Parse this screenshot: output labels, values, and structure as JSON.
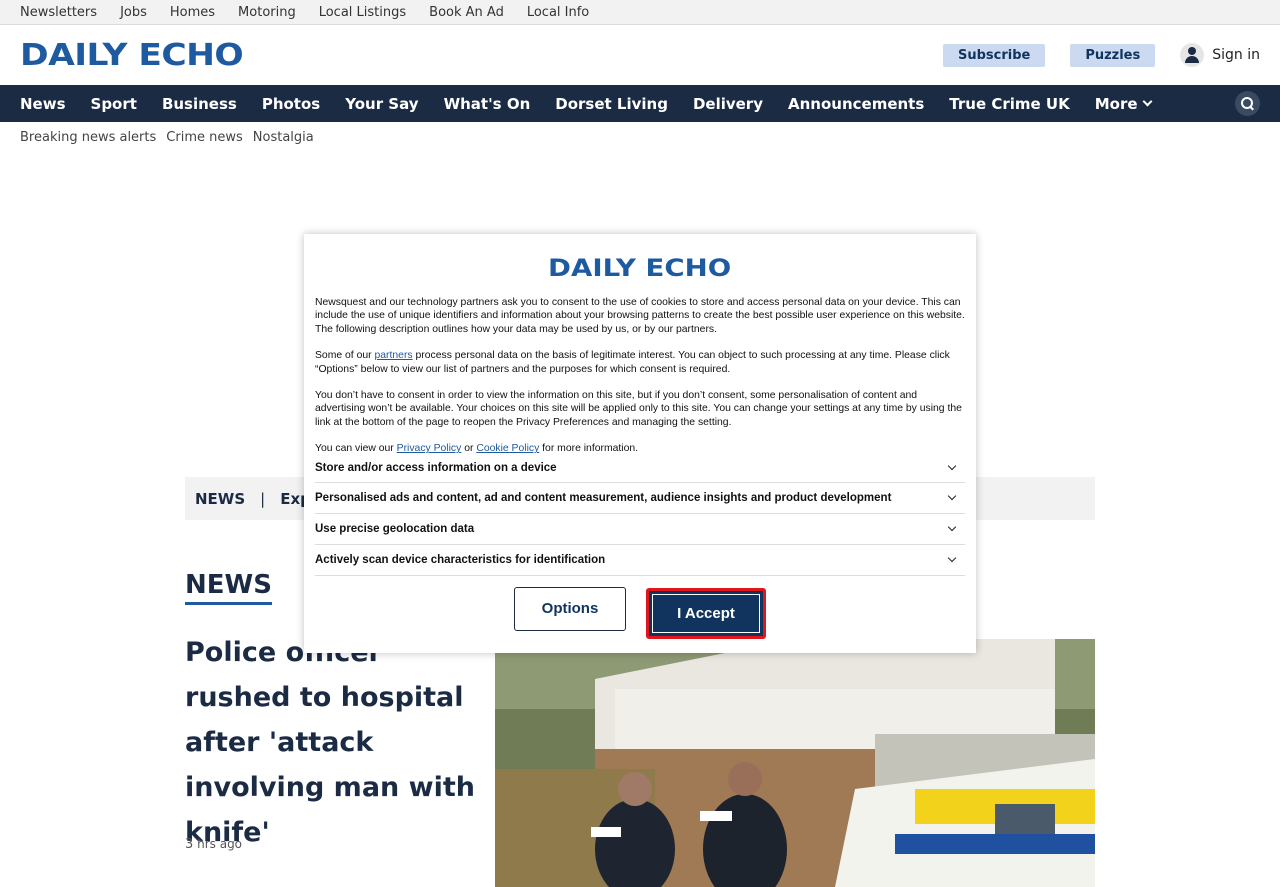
{
  "topbar": {
    "links": [
      "Newsletters",
      "Jobs",
      "Homes",
      "Motoring",
      "Local Listings",
      "Book An Ad",
      "Local Info"
    ]
  },
  "masthead": {
    "logo": "DAILY ECHO",
    "subscribe": "Subscribe",
    "puzzles": "Puzzles",
    "signin": "Sign in"
  },
  "mainnav": {
    "items": [
      "News",
      "Sport",
      "Business",
      "Photos",
      "Your Say",
      "What's On",
      "Dorset Living",
      "Delivery",
      "Announcements",
      "True Crime UK"
    ],
    "more": "More"
  },
  "subnav": {
    "items": [
      "Breaking news alerts",
      "Crime news",
      "Nostalgia"
    ]
  },
  "section_bar": {
    "label": "NEWS",
    "sep": "|",
    "next": "Exp"
  },
  "article": {
    "section": "NEWS",
    "headline": "Police officer rushed to hospital after 'attack involving man with knife'",
    "time_num": "3",
    "time_unit": "hrs ago"
  },
  "modal": {
    "logo": "DAILY ECHO",
    "para1": "Newsquest and our technology partners ask you to consent to the use of cookies to store and access personal data on your device. This can include the use of unique identifiers and information about your browsing patterns to create the best possible user experience on this website. The following description outlines how your data may be used by us, or by our partners.",
    "para2_pre": "Some of our ",
    "para2_link": "partners",
    "para2_post": " process personal data on the basis of legitimate interest. You can object to such processing at any time. Please click “Options” below to view our list of partners and the purposes for which consent is required.",
    "para3": "You don’t have to consent in order to view the information on this site, but if you don’t consent, some personalisation of content and advertising won’t be available. Your choices on this site will be applied only to this site. You can change your settings at any time by using the link at the bottom of the page to reopen the Privacy Preferences and managing the setting.",
    "para4_pre": "You can view our ",
    "para4_link1": "Privacy Policy",
    "para4_mid": " or ",
    "para4_link2": "Cookie Policy",
    "para4_post": " for more information.",
    "purposes": [
      "Store and/or access information on a device",
      "Personalised ads and content, ad and content measurement, audience insights and product development",
      "Use precise geolocation data",
      "Actively scan device characteristics for identification"
    ],
    "options_label": "Options",
    "accept_label": "I Accept"
  },
  "colors": {
    "brand_blue": "#1e5aa0",
    "nav_navy": "#1b2b44",
    "button_navy": "#10345e",
    "highlight_red": "#e0161b"
  }
}
